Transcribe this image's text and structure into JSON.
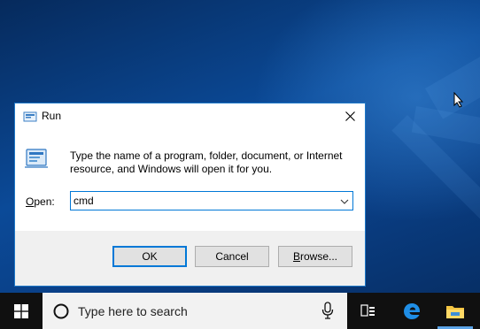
{
  "dialog": {
    "title": "Run",
    "description": "Type the name of a program, folder, document, or Internet resource, and Windows will open it for you.",
    "open_label_underlined": "O",
    "open_label_rest": "pen:",
    "open_value": "cmd",
    "buttons": {
      "ok": "OK",
      "cancel": "Cancel",
      "browse_underlined": "B",
      "browse_rest": "rowse..."
    }
  },
  "taskbar": {
    "search_placeholder": "Type here to search",
    "icons": [
      "windows-start-icon",
      "search-circle-icon",
      "microphone-icon",
      "task-view-icon",
      "edge-icon",
      "file-explorer-icon"
    ]
  },
  "colors": {
    "dialog_border": "#1e78c8",
    "accent": "#0078d7",
    "taskbar": "#101010",
    "search_box": "#f2f2f2"
  }
}
